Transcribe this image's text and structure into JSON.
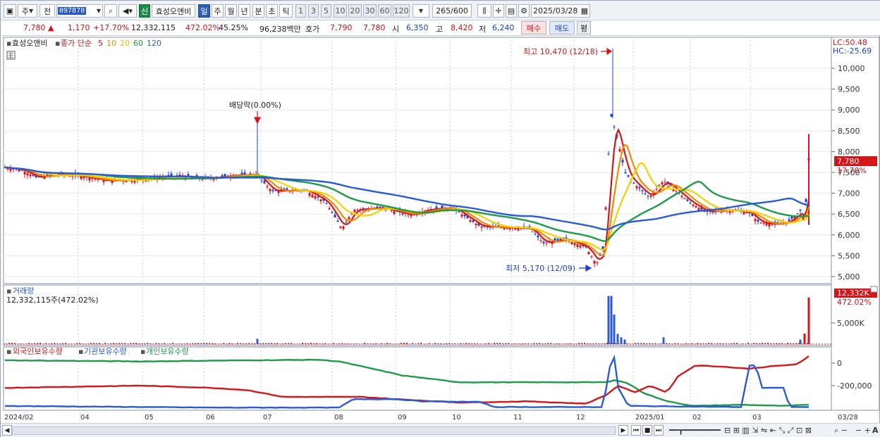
{
  "toolbar": {
    "mode": "주",
    "prev": "전",
    "code": "097870",
    "badge_new": "신",
    "stock_name": "효성오앤비",
    "periods": [
      "일",
      "주",
      "월",
      "년",
      "분",
      "초",
      "틱"
    ],
    "ranges": [
      "1",
      "3",
      "5",
      "10",
      "20",
      "30",
      "60",
      "120"
    ],
    "count": "265/600",
    "date": "2025/03/28"
  },
  "quote": {
    "price": "7,780",
    "change": "1,170",
    "change_pct": "+17.70%",
    "volume": "12,332,115",
    "volume_pct": "472.02%",
    "turnover_pct": "45.25%",
    "amount": "96,238백만",
    "ask_label": "호가",
    "ask": "7,790",
    "bid": "7,780",
    "open_label": "시",
    "open": "6,350",
    "high_label": "고",
    "high": "8,420",
    "low_label": "저",
    "low": "6,240",
    "buy": "매수",
    "sell": "매도",
    "eval": "평"
  },
  "price_panel": {
    "name": "효성오앤비",
    "ma_title": "종가 단순",
    "ma_periods": [
      "5",
      "10",
      "20",
      "60",
      "120"
    ],
    "ma_colors": [
      "#d4151a",
      "#f08a00",
      "#f5d000",
      "#1f9a4a",
      "#2a5ad6"
    ],
    "dividend_note": "배당락(0.00%)",
    "high_note": "최고 10,470 (12/18)",
    "low_note": "최저 5,170 (12/09)",
    "lc": "LC:50.48",
    "hc": "HC:-25.69",
    "last_price": "7,780",
    "last_pct": "17.70%",
    "y_ticks": [
      "10,000",
      "9,500",
      "9,000",
      "8,500",
      "8,000",
      "7,500",
      "7,000",
      "6,500",
      "6,000",
      "5,500",
      "5,000"
    ]
  },
  "volume_panel": {
    "title": "거래량",
    "value": "12,332,115주(472.02%)",
    "last": "12,332K",
    "last_pct": "472.02%",
    "tick": "5,000K"
  },
  "holding_panel": {
    "series": [
      "외국인보유수량",
      "기관보유수량",
      "개인보유수량"
    ],
    "colors": [
      "#d4151a",
      "#2a5ad6",
      "#1f9a4a"
    ],
    "ticks": [
      "0",
      "-200,000"
    ]
  },
  "x_axis": {
    "labels": [
      "2024/02",
      "04",
      "05",
      "06",
      "07",
      "08",
      "09",
      "10",
      "11",
      "12",
      "2025/01",
      "02",
      "03"
    ],
    "end_label": "03/28"
  }
}
